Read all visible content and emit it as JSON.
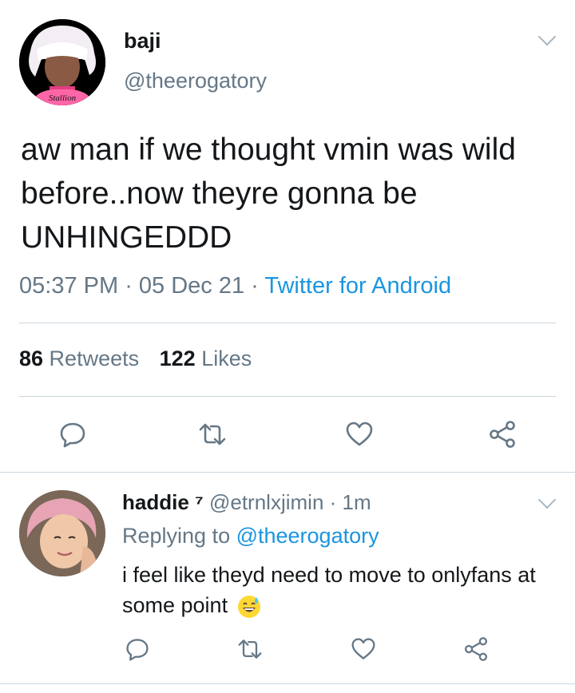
{
  "main_tweet": {
    "author_name": "baji",
    "author_handle": "@theerogatory",
    "text": "aw man if we thought vmin was wild before..now theyre gonna be UNHINGEDDD",
    "time": "05:37 PM",
    "separator": " · ",
    "date": "05 Dec 21",
    "source": "Twitter for Android",
    "retweets_count": "86",
    "retweets_label": " Retweets",
    "likes_count": "122",
    "likes_label": " Likes",
    "avatar_caption": "Stallion"
  },
  "reply": {
    "author_name": "haddie ⁷",
    "author_handle": "@etrnlxjimin",
    "separator": " · ",
    "time": "1m",
    "replying_prefix": "Replying to ",
    "replying_handle": "@theerogatory",
    "text": "i feel like theyd need to move to onlyfans at some point"
  },
  "icons": [
    "reply-icon",
    "retweet-icon",
    "like-icon",
    "share-icon",
    "chevron-down-icon"
  ],
  "colors": {
    "accent": "#1b95e0",
    "secondary_text": "#657786",
    "divider": "#ccd6dd",
    "icon": "#657786"
  }
}
